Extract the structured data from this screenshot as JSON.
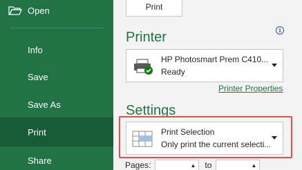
{
  "nav": {
    "open_label": "Open",
    "items": [
      {
        "label": "Info"
      },
      {
        "label": "Save"
      },
      {
        "label": "Save As"
      },
      {
        "label": "Print",
        "selected": true
      },
      {
        "label": "Share"
      }
    ]
  },
  "print_button_label": "Print",
  "printer": {
    "title": "Printer",
    "name": "HP Photosmart Prem C410...",
    "status": "Ready",
    "properties_link": "Printer Properties"
  },
  "settings": {
    "title": "Settings",
    "selection_title": "Print Selection",
    "selection_desc": "Only print the current selecti..."
  },
  "pages": {
    "label": "Pages:",
    "to_label": "to",
    "from_value": "",
    "to_value": ""
  },
  "colors": {
    "nav_bg": "#217346",
    "nav_selected": "#185c37",
    "accent": "#217346",
    "highlight": "#e64b4b"
  }
}
